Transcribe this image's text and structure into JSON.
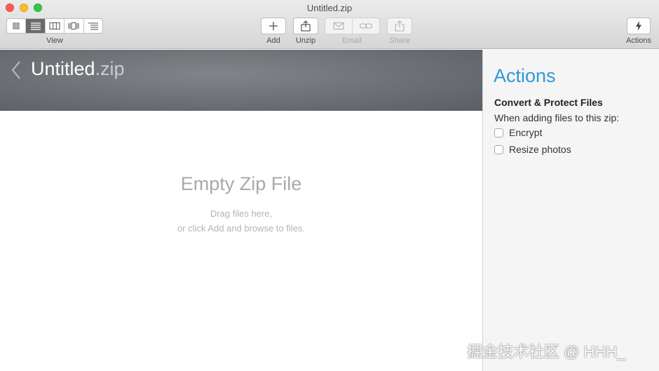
{
  "window": {
    "title": "Untitled.zip"
  },
  "toolbar": {
    "view_label": "View",
    "view_modes": [
      {
        "icon": "grid-view-icon",
        "active": false
      },
      {
        "icon": "list-view-icon",
        "active": true
      },
      {
        "icon": "column-view-icon",
        "active": false
      },
      {
        "icon": "coverflow-view-icon",
        "active": false
      },
      {
        "icon": "outline-view-icon",
        "active": false
      }
    ],
    "add_label": "Add",
    "unzip_label": "Unzip",
    "email_label": "Email",
    "share_label": "Share",
    "actions_label": "Actions"
  },
  "main": {
    "title_name": "Untitled",
    "title_ext": ".zip",
    "empty_title": "Empty Zip File",
    "empty_hint_1": "Drag files here,",
    "empty_hint_2": "or click Add and browse to files."
  },
  "actions_panel": {
    "heading": "Actions",
    "section_title": "Convert & Protect Files",
    "subtitle": "When adding files to this zip:",
    "options": [
      {
        "label": "Encrypt",
        "checked": false
      },
      {
        "label": "Resize photos",
        "checked": false
      }
    ]
  },
  "watermark": "掘金技术社区 @ HHH_",
  "colors": {
    "accent": "#2f9ad6",
    "header_band": "#6c7074"
  }
}
